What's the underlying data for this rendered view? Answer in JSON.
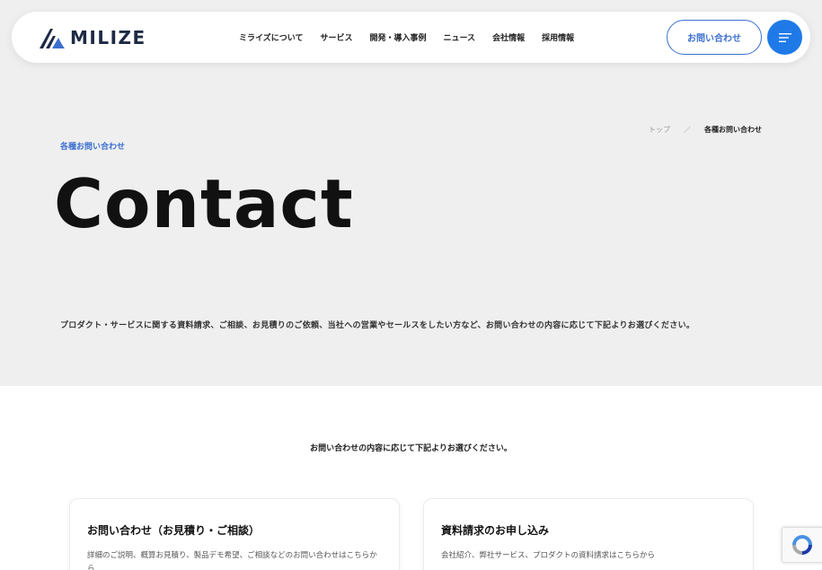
{
  "header": {
    "logo_text": "MILIZE",
    "nav": [
      {
        "label": "ミライズについて"
      },
      {
        "label": "サービス"
      },
      {
        "label": "開発・導入事例"
      },
      {
        "label": "ニュース"
      },
      {
        "label": "会社情報"
      },
      {
        "label": "採用情報"
      }
    ],
    "contact_label": "お問い合わせ",
    "menu_icon": "hamburger-icon"
  },
  "breadcrumb": {
    "top": "トップ",
    "separator": "／",
    "current": "各種お問い合わせ"
  },
  "hero": {
    "eyebrow": "各種お問い合わせ",
    "title": "Contact",
    "intro": "プロダクト・サービスに関する資料請求、ご相談、お見積りのご依頼、当社への営業やセールスをしたい方など、お問い合わせの内容に応じて下記よりお選びください。"
  },
  "selection": {
    "prompt": "お問い合わせの内容に応じて下記よりお選びください。",
    "cards": [
      {
        "title": "お問い合わせ（お見積り・ご相談）",
        "desc": "詳細のご説明、概算お見積り、製品デモ希望、ご相談などのお問い合わせはこちらから"
      },
      {
        "title": "資料請求のお申し込み",
        "desc": "会社紹介、弊社サービス、プロダクトの資料請求はこちらから"
      }
    ]
  },
  "colors": {
    "accent": "#3b6fcf",
    "menu_button": "#1f7ae8",
    "hero_bg": "#efefef",
    "logo": "#1e2a45"
  }
}
